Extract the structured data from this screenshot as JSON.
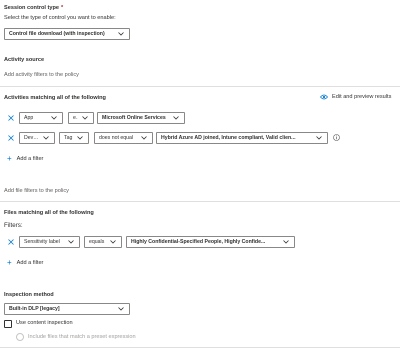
{
  "session_control": {
    "title": "Session control type",
    "required_mark": "*",
    "description": "Select the type of control you want to enable:",
    "selected": "Control file download (with inspection)"
  },
  "activity_source": {
    "title": "Activity source",
    "add_filters_text": "Add activity filters to the policy"
  },
  "activities": {
    "title": "Activities matching all of the following",
    "edit_preview_label": "Edit and preview results",
    "filters": [
      {
        "field": "App",
        "operator": "equals",
        "value": "Microsoft Online Services"
      },
      {
        "field": "Device",
        "subfield": "Tag",
        "operator": "does not equal",
        "value": "Hybrid Azure AD joined, Intune compliant, Valid clien..."
      }
    ],
    "add_filter_label": "Add a filter"
  },
  "file_filters": {
    "add_filters_text": "Add file filters to the policy"
  },
  "files": {
    "title": "Files matching all of the following",
    "filters_label": "Filters:",
    "filters": [
      {
        "field": "Sensitivity label",
        "operator": "equals",
        "value": "Highly Confidential-Specified People, Highly Confide..."
      }
    ],
    "add_filter_label": "Add a filter"
  },
  "inspection": {
    "title": "Inspection method",
    "selected": "Built-in DLP [legacy]",
    "use_content_inspection": "Use content inspection",
    "include_files_text": "Include files that match a preset expression"
  },
  "colors": {
    "accent": "#0078d4",
    "text": "#323130",
    "border": "#8a8886",
    "divider": "#e1dfdd",
    "required": "#a4262c"
  }
}
